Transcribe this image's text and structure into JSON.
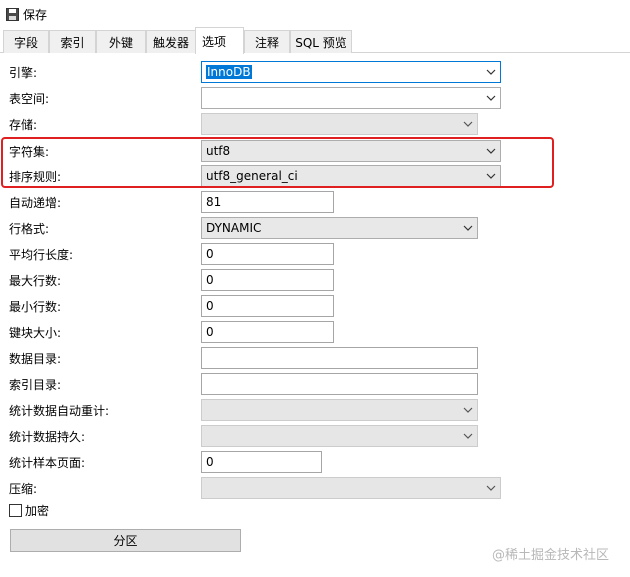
{
  "toolbar": {
    "save_label": "保存",
    "save_icon": "floppy-disk-icon"
  },
  "tabs": [
    {
      "label": "字段"
    },
    {
      "label": "索引"
    },
    {
      "label": "外键"
    },
    {
      "label": "触发器"
    },
    {
      "label": "选项",
      "active": true
    },
    {
      "label": "注释"
    },
    {
      "label": "SQL 预览"
    }
  ],
  "form": {
    "engine": {
      "label": "引擎:",
      "value": "InnoDB"
    },
    "tablespace": {
      "label": "表空间:",
      "value": ""
    },
    "storage": {
      "label": "存储:",
      "value": ""
    },
    "charset": {
      "label": "字符集:",
      "value": "utf8"
    },
    "collation": {
      "label": "排序规则:",
      "value": "utf8_general_ci"
    },
    "auto_increment": {
      "label": "自动递增:",
      "value": "81"
    },
    "row_format": {
      "label": "行格式:",
      "value": "DYNAMIC"
    },
    "avg_row_length": {
      "label": "平均行长度:",
      "value": "0"
    },
    "max_rows": {
      "label": "最大行数:",
      "value": "0"
    },
    "min_rows": {
      "label": "最小行数:",
      "value": "0"
    },
    "key_block_size": {
      "label": "键块大小:",
      "value": "0"
    },
    "data_directory": {
      "label": "数据目录:",
      "value": ""
    },
    "index_directory": {
      "label": "索引目录:",
      "value": ""
    },
    "stats_auto_recalc": {
      "label": "统计数据自动重计:",
      "value": ""
    },
    "stats_persistent": {
      "label": "统计数据持久:",
      "value": ""
    },
    "stats_sample_pages": {
      "label": "统计样本页面:",
      "value": "0"
    },
    "compression": {
      "label": "压缩:",
      "value": ""
    },
    "encryption": {
      "label": "加密",
      "checked": false
    },
    "partition_button": "分区"
  },
  "colors": {
    "highlight_border": "#e02020",
    "selection": "#0078d7"
  },
  "watermark": "@稀土掘金技术社区"
}
